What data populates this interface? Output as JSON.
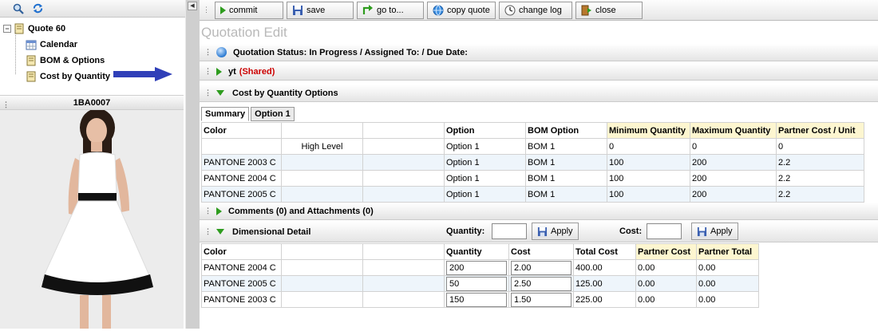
{
  "left_panel": {
    "tree": {
      "root_label": "Quote 60",
      "children": [
        {
          "label": "Calendar"
        },
        {
          "label": "BOM & Options"
        },
        {
          "label": "Cost by Quantity"
        }
      ]
    },
    "product_code": "1BA0007"
  },
  "toolbar": {
    "buttons": [
      {
        "label": "commit"
      },
      {
        "label": "save"
      },
      {
        "label": "go to..."
      },
      {
        "label": "copy quote"
      },
      {
        "label": "change log"
      },
      {
        "label": "close"
      }
    ]
  },
  "page_title": "Quotation Edit",
  "sections": {
    "status": "Quotation Status: In Progress / Assigned To: / Due Date:",
    "yt_label": "yt",
    "yt_shared": "(Shared)",
    "cost_by_qty": "Cost by Quantity Options",
    "comments": "Comments (0) and Attachments (0)",
    "dimensional": "Dimensional Detail"
  },
  "tabs": [
    {
      "label": "Summary",
      "active": true
    },
    {
      "label": "Option 1",
      "active": false
    }
  ],
  "summary_table": {
    "headers": [
      "Color",
      "",
      "",
      "Option",
      "BOM Option",
      "Minimum Quantity",
      "Maximum Quantity",
      "Partner Cost / Unit"
    ],
    "rows": [
      [
        "",
        "High Level",
        "",
        "Option 1",
        "BOM 1",
        "0",
        "0",
        "0"
      ],
      [
        "PANTONE 2003 C",
        "",
        "",
        "Option 1",
        "BOM 1",
        "100",
        "200",
        "2.2"
      ],
      [
        "PANTONE 2004 C",
        "",
        "",
        "Option 1",
        "BOM 1",
        "100",
        "200",
        "2.2"
      ],
      [
        "PANTONE 2005 C",
        "",
        "",
        "Option 1",
        "BOM 1",
        "100",
        "200",
        "2.2"
      ]
    ]
  },
  "dimensional": {
    "quantity_label": "Quantity:",
    "cost_label": "Cost:",
    "apply_label": "Apply",
    "headers": [
      "Color",
      "",
      "",
      "Quantity",
      "Cost",
      "Total Cost",
      "Partner Cost",
      "Partner Total"
    ],
    "rows": [
      [
        "PANTONE 2004 C",
        "",
        "",
        "200",
        "2.00",
        "400.00",
        "0.00",
        "0.00"
      ],
      [
        "PANTONE 2005 C",
        "",
        "",
        "50",
        "2.50",
        "125.00",
        "0.00",
        "0.00"
      ],
      [
        "PANTONE 2003 C",
        "",
        "",
        "150",
        "1.50",
        "225.00",
        "0.00",
        "0.00"
      ]
    ]
  },
  "colors": {
    "accent_green": "#2e9c1e",
    "shared_red": "#cc0000",
    "header_highlight": "#fdf6d0",
    "arrow_blue": "#2f3fb8"
  }
}
